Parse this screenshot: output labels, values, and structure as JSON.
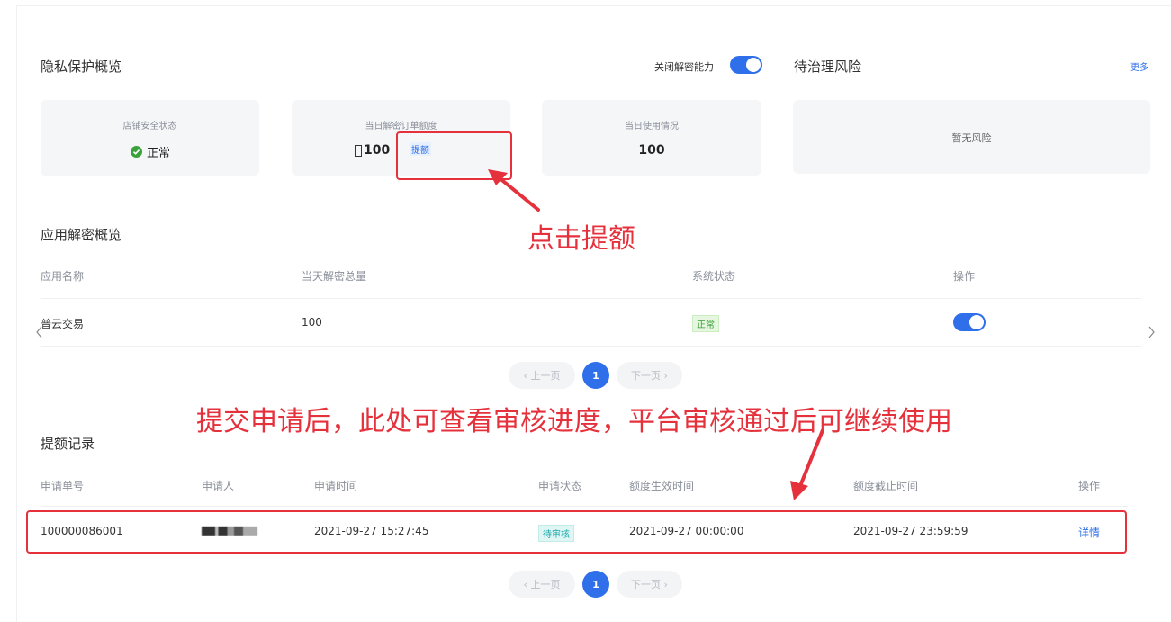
{
  "privacy": {
    "title": "隐私保护概览",
    "toggle_label": "关闭解密能力",
    "cards": {
      "shop_status_label": "店铺安全状态",
      "shop_status_value": "正常",
      "quota_label": "当日解密订单额度",
      "quota_value": "100",
      "quota_link": "提额",
      "usage_label": "当日使用情况",
      "usage_value": "100"
    }
  },
  "risk": {
    "title": "待治理风险",
    "more": "更多",
    "empty": "暂无风险"
  },
  "apps": {
    "title": "应用解密概览",
    "headers": [
      "应用名称",
      "当天解密总量",
      "系统状态",
      "操作"
    ],
    "rows": [
      {
        "name": "普云交易",
        "total": "100",
        "status": "正常",
        "enabled": true
      }
    ]
  },
  "pagination": {
    "prev": "‹ 上一页",
    "page": "1",
    "next": "下一页 ›"
  },
  "records": {
    "title": "提额记录",
    "headers": [
      "申请单号",
      "申请人",
      "申请时间",
      "申请状态",
      "额度生效时间",
      "额度截止时间",
      "操作"
    ],
    "rows": [
      {
        "id": "100000086001",
        "applicant": "",
        "time": "2021-09-27 15:27:45",
        "status": "待审核",
        "start": "2021-09-27 00:00:00",
        "end": "2021-09-27 23:59:59",
        "action": "详情"
      }
    ]
  },
  "annotations": {
    "click_tip": "点击提额",
    "submit_tip": "提交申请后，此处可查看审核进度，平台审核通过后可继续使用"
  },
  "colors": {
    "accent": "#2f6fea",
    "annotation_red": "#e5313c",
    "success_green": "#3aa23a"
  },
  "icons": [
    "check-circle-icon",
    "chevron-left-icon",
    "chevron-right-icon",
    "arrow-icon"
  ]
}
